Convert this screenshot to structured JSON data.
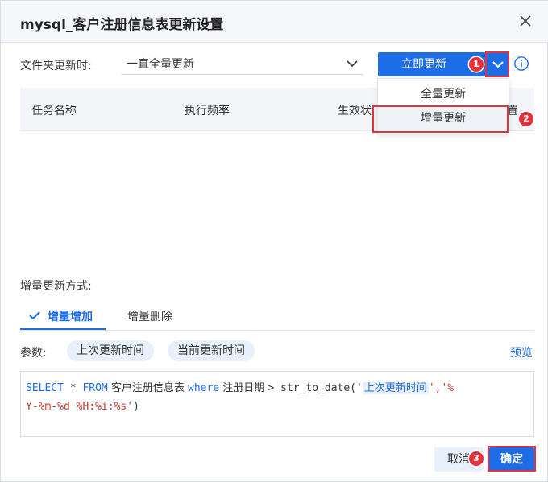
{
  "dialog": {
    "title": "mysql_客户注册信息表更新设置"
  },
  "folder_update": {
    "label": "文件夹更新时:",
    "selected": "一直全量更新",
    "update_now_label": "立即更新",
    "options": [
      "全量更新",
      "增量更新"
    ]
  },
  "table": {
    "columns": [
      "任务名称",
      "执行频率",
      "生效状",
      "置"
    ]
  },
  "incremental": {
    "label": "增量更新方式:",
    "tabs": [
      "增量增加",
      "增量删除"
    ],
    "params_label": "参数:",
    "params": [
      "上次更新时间",
      "当前更新时间"
    ],
    "preview_label": "预览"
  },
  "sql": {
    "select": "SELECT",
    "star": " * ",
    "from": "FROM",
    "table": " 客户注册信息表 ",
    "where": "where",
    "field": " 注册日期 ",
    "rest": "> str_to_date('",
    "token": "上次更新时间",
    "fmt1": "','%",
    "fmt2": "Y-%m-%d %H:%i:%s'",
    "close": ")"
  },
  "footer": {
    "cancel": "取消",
    "ok": "确定"
  },
  "annotations": [
    "1",
    "2",
    "3"
  ],
  "colors": {
    "primary": "#1d6ee6",
    "annotation": "#e2323c",
    "chip_bg": "#e8f0fb"
  }
}
